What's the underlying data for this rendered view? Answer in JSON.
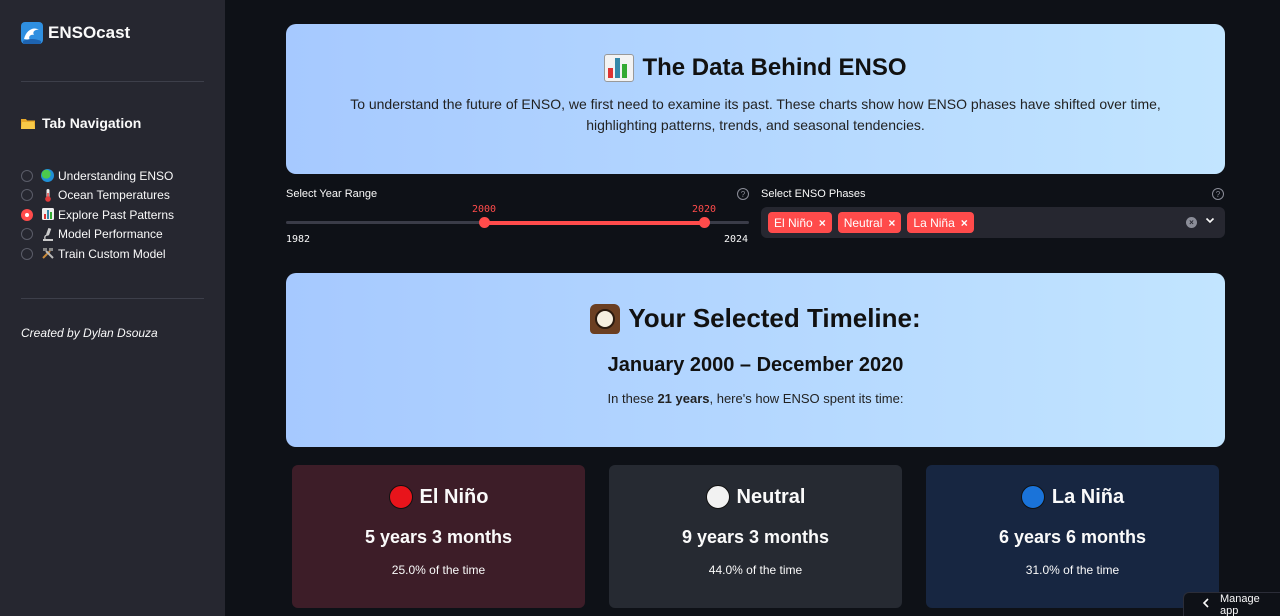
{
  "sidebar": {
    "app_name": "ENSOcast",
    "nav_title": "Tab Navigation",
    "items": [
      {
        "label": "Understanding ENSO",
        "selected": false,
        "icon": "globe-icon"
      },
      {
        "label": "Ocean Temperatures",
        "selected": false,
        "icon": "thermometer-icon"
      },
      {
        "label": "Explore Past Patterns",
        "selected": true,
        "icon": "bar-chart-icon"
      },
      {
        "label": "Model Performance",
        "selected": false,
        "icon": "microscope-icon"
      },
      {
        "label": "Train Custom Model",
        "selected": false,
        "icon": "tools-icon"
      }
    ],
    "credit": "Created by Dylan Dsouza"
  },
  "hero": {
    "title": "The Data Behind ENSO",
    "text": "To understand the future of ENSO, we first need to examine its past. These charts show how ENSO phases have shifted over time, highlighting patterns, trends, and seasonal tendencies."
  },
  "year_range": {
    "label": "Select Year Range",
    "min": "1982",
    "max": "2024",
    "start": "2000",
    "end": "2020",
    "start_value": 2000,
    "end_value": 2020,
    "min_value": 1982,
    "max_value": 2024
  },
  "phases_select": {
    "label": "Select ENSO Phases",
    "tags": [
      "El Niño",
      "Neutral",
      "La Niña"
    ]
  },
  "timeline": {
    "title": "Your Selected Timeline:",
    "range": "January 2000 – December 2020",
    "sub_prefix": "In these",
    "sub_years": "21 years",
    "sub_suffix": ", here's how ENSO spent its time:"
  },
  "phase_cards": [
    {
      "name": "El Niño",
      "duration": "5 years 3 months",
      "pct": "25.0% of the time",
      "dot_color": "#e8141b",
      "bg": "#3d1d28"
    },
    {
      "name": "Neutral",
      "duration": "9 years 3 months",
      "pct": "44.0% of the time",
      "dot_color": "#f2f2f2",
      "bg": "#262a32"
    },
    {
      "name": "La Niña",
      "duration": "6 years 6 months",
      "pct": "31.0% of the time",
      "dot_color": "#1a73d9",
      "bg": "#172641"
    }
  ],
  "footer": {
    "manage_label": "Manage app"
  },
  "colors": {
    "accent": "#ff4b4b",
    "sidebar_bg": "#262730",
    "main_bg": "#0e1117"
  }
}
